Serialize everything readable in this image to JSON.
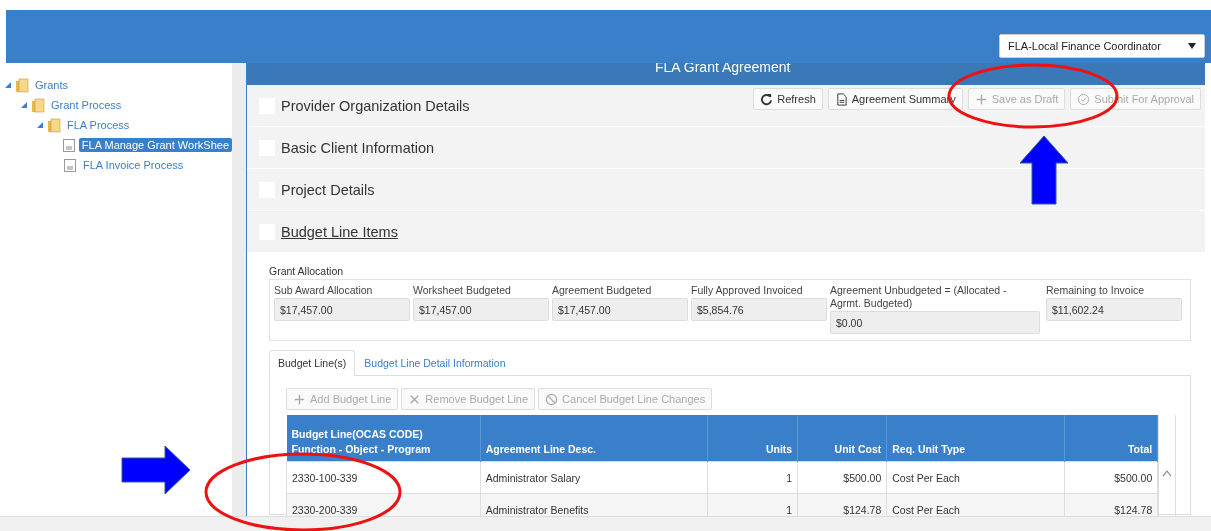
{
  "header": {
    "role_select": "FLA-Local Finance Coordinator"
  },
  "tree": [
    {
      "label": "Grants",
      "kind": "folder",
      "expanded": true,
      "selected": false,
      "children": [
        {
          "label": "Grant Process",
          "kind": "folder",
          "expanded": true,
          "selected": false,
          "children": [
            {
              "label": "FLA Process",
              "kind": "folder",
              "expanded": true,
              "selected": false,
              "children": [
                {
                  "label": "FLA Manage Grant WorkShee",
                  "kind": "document",
                  "selected": true
                },
                {
                  "label": "FLA Invoice Process",
                  "kind": "document",
                  "selected": false
                }
              ]
            }
          ]
        }
      ]
    }
  ],
  "panel_title": "FLA Grant Agreement",
  "toolbar": [
    {
      "label": "Refresh",
      "disabled": false
    },
    {
      "label": "Agreement Summary",
      "disabled": false
    },
    {
      "label": "Save as Draft",
      "disabled": true
    },
    {
      "label": "Submit For Approval",
      "disabled": true
    }
  ],
  "sections": [
    {
      "label": "Provider Organization Details",
      "checked": false,
      "expanded": false
    },
    {
      "label": "Basic Client Information",
      "checked": false,
      "expanded": false
    },
    {
      "label": "Project Details",
      "checked": false,
      "expanded": false
    },
    {
      "label": "Budget Line Items",
      "checked": false,
      "expanded": true
    }
  ],
  "grant_allocation": {
    "title": "Grant Allocation",
    "fields": [
      {
        "label": "Sub Award Allocation",
        "value": "$17,457.00"
      },
      {
        "label": "Worksheet Budgeted",
        "value": "$17,457.00"
      },
      {
        "label": "Agreement Budgeted",
        "value": "$17,457.00"
      },
      {
        "label": "Fully Approved Invoiced",
        "value": "$5,854.76"
      },
      {
        "label": "Agreement Unbudgeted = (Allocated - Agrmt. Budgeted)",
        "value": "$0.00"
      },
      {
        "label": "Remaining to Invoice",
        "value": "$11,602.24"
      }
    ]
  },
  "tabs": [
    {
      "label": "Budget Line(s)",
      "selected": true
    },
    {
      "label": "Budget Line Detail Information",
      "selected": false
    }
  ],
  "line_buttons": [
    {
      "label": "Add Budget Line",
      "disabled": true
    },
    {
      "label": "Remove Budget Line",
      "disabled": true
    },
    {
      "label": "Cancel Budget Line Changes",
      "disabled": true
    }
  ],
  "table": {
    "columns": [
      {
        "label": "Budget Line(OCAS CODE)",
        "label_2": "Function - Object - Program"
      },
      {
        "label": "Agreement Line Desc."
      },
      {
        "label": "Units"
      },
      {
        "label": "Unit Cost"
      },
      {
        "label": "Req. Unit Type"
      },
      {
        "label": "Total"
      }
    ],
    "rows": [
      [
        "2330-100-339",
        "Administrator Salary",
        "1",
        "$500.00",
        "Cost Per Each",
        "$500.00"
      ],
      [
        "2330-200-339",
        "Administrator Benefits",
        "1",
        "$124.78",
        "Cost Per Each",
        "$124.78"
      ]
    ]
  }
}
